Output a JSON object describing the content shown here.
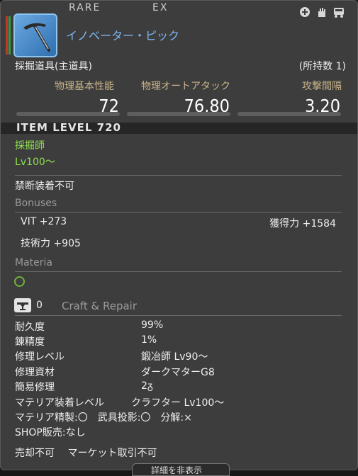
{
  "header": {
    "rarity": "RARE",
    "ex": "EX",
    "item_name": "イノベーター・ピック",
    "icons": [
      "plus-icon",
      "hand-icon",
      "trolley-icon"
    ]
  },
  "item": {
    "type": "採掘道具(主道具)",
    "owned": "(所持数 1)"
  },
  "stats": {
    "labels": [
      "物理基本性能",
      "物理オートアタック",
      "攻撃間隔"
    ],
    "values": [
      "72",
      "76.80",
      "3.20"
    ]
  },
  "item_level": "ITEM LEVEL 720",
  "job": "採掘師",
  "level_req": "Lv100～",
  "restriction": "禁断装着不可",
  "bonuses": {
    "title": "Bonuses",
    "items": [
      {
        "label": "VIT +273"
      },
      {
        "label": "獲得力 +1584"
      },
      {
        "label": "技術力 +905"
      }
    ]
  },
  "materia": {
    "title": "Materia"
  },
  "craft": {
    "count": "0",
    "title": "Craft & Repair",
    "rows": [
      {
        "key": "耐久度",
        "value": "99%"
      },
      {
        "key": "錬精度",
        "value": "1%"
      },
      {
        "key": "修理レベル",
        "value": "鍛冶師 Lv90～"
      },
      {
        "key": "修理資材",
        "value": "ダークマターG8"
      },
      {
        "key": "簡易修理",
        "value": "2ᵹ"
      },
      {
        "key": "マテリア装着レベル",
        "value": "クラフター Lv100～"
      }
    ],
    "flags": "マテリア精製:〇　武具投影:〇　分解:×",
    "shop": "SHOP販売:なし"
  },
  "trade": "売却不可　 マーケット取引不可",
  "footer_tab": "詳細を非表示",
  "colors": {
    "panel": "#3d3d3d",
    "name": "#7fb8f5",
    "label": "#c9b48a",
    "green": "#8fe04f"
  }
}
